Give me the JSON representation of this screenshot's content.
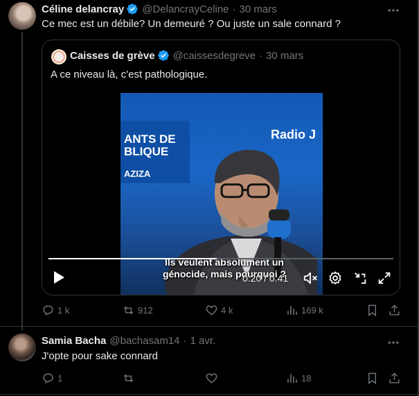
{
  "tweet1": {
    "name": "Céline delancray",
    "handle": "@DelancrayCeline",
    "separator": "·",
    "date": "30 mars",
    "text": "Ce mec est un débile? Un demeuré ? Ou juste un sale connard ?",
    "more_icon": "more-dots-icon",
    "verified": true
  },
  "quote": {
    "name": "Caisses de grève",
    "handle": "@caissesdegreve",
    "separator": "·",
    "date": "30 mars",
    "text": "A ce niveau là, c'est pathologique.",
    "verified": true
  },
  "video": {
    "studio_line1": "ANTS DE",
    "studio_line2": "BLIQUE",
    "studio_line3": "AZIZA",
    "radio_brand": "Radio J",
    "subtitle_line1": "Ils veulent absolument un",
    "subtitle_line2": "génocide, mais pourquoi ?",
    "time": "0:20 / 0:41",
    "progress": 0.488,
    "controls": [
      "play-icon",
      "mute-icon",
      "settings-icon",
      "collapse-icon",
      "fullscreen-icon"
    ]
  },
  "tweet1_actions": {
    "replies": "1 k",
    "reposts": "912",
    "likes": "4 k",
    "views": "169 k"
  },
  "tweet2": {
    "name": "Samia Bacha",
    "handle": "@bachasam14",
    "separator": "·",
    "date": "1 avr.",
    "text": "J'opte pour sake connard",
    "verified": false
  },
  "tweet2_actions": {
    "replies": "1",
    "reposts": "",
    "likes": "",
    "views": "18"
  },
  "colors": {
    "background": "#000000",
    "text": "#e7e9ea",
    "muted": "#71767b",
    "verified": "#1d9bf0",
    "border": "#2f3336"
  }
}
